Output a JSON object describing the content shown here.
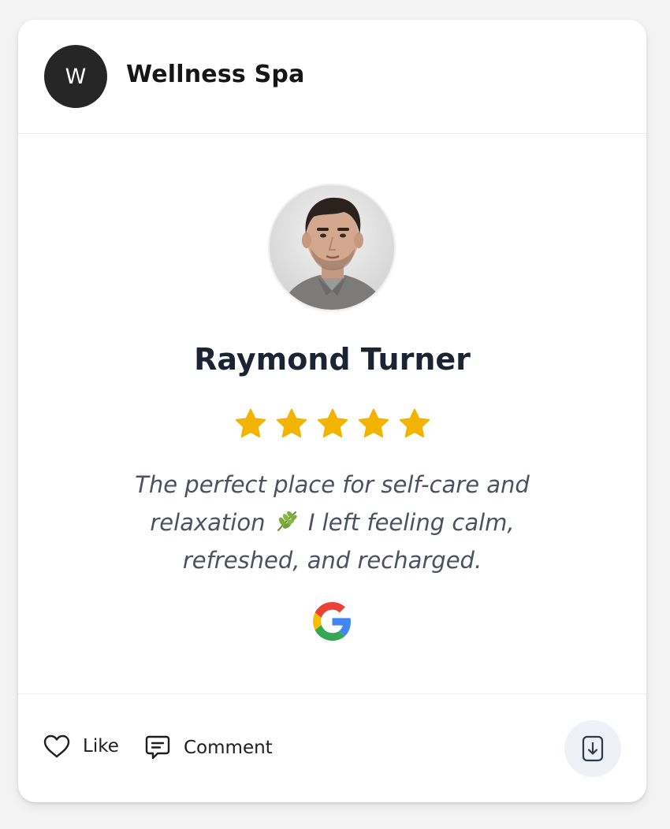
{
  "header": {
    "avatar_initial": "W",
    "business_name": "Wellness Spa"
  },
  "review": {
    "reviewer_name": "Raymond Turner",
    "rating": 5,
    "max_rating": 5,
    "text_lines": [
      "The perfect place for self-care and",
      "relaxation",
      "I left feeling calm,",
      "refreshed, and recharged."
    ],
    "source_icon": "google-icon"
  },
  "footer": {
    "like_label": "Like",
    "comment_label": "Comment",
    "save_icon": "download-icon"
  },
  "colors": {
    "star": "#f2b400",
    "avatar_bg": "#262626",
    "name": "#1b2433",
    "review_text": "#4a5160",
    "save_button_bg": "#eef1f5"
  }
}
